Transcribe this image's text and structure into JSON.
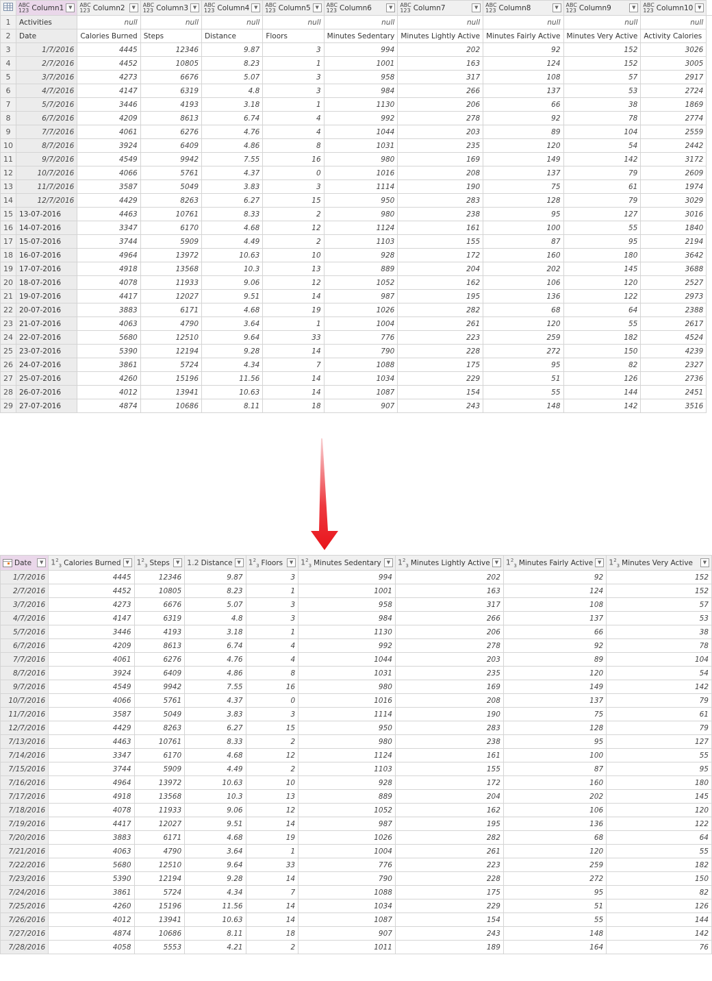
{
  "top_table": {
    "columns": [
      {
        "type": "ABC\n123",
        "name": "Column1"
      },
      {
        "type": "ABC\n123",
        "name": "Column2"
      },
      {
        "type": "ABC\n123",
        "name": "Column3"
      },
      {
        "type": "ABC\n123",
        "name": "Column4"
      },
      {
        "type": "ABC\n123",
        "name": "Column5"
      },
      {
        "type": "ABC\n123",
        "name": "Column6"
      },
      {
        "type": "ABC\n123",
        "name": "Column7"
      },
      {
        "type": "ABC\n123",
        "name": "Column8"
      },
      {
        "type": "ABC\n123",
        "name": "Column9"
      },
      {
        "type": "ABC\n123",
        "name": "Column10"
      }
    ],
    "rows": [
      [
        "Activities",
        "null",
        "null",
        "null",
        "null",
        "null",
        "null",
        "null",
        "null",
        "null"
      ],
      [
        "Date",
        "Calories Burned",
        "Steps",
        "Distance",
        "Floors",
        "Minutes Sedentary",
        "Minutes Lightly Active",
        "Minutes Fairly Active",
        "Minutes Very Active",
        "Activity Calories"
      ],
      [
        "1/7/2016",
        "4445",
        "12346",
        "9.87",
        "3",
        "994",
        "202",
        "92",
        "152",
        "3026"
      ],
      [
        "2/7/2016",
        "4452",
        "10805",
        "8.23",
        "1",
        "1001",
        "163",
        "124",
        "152",
        "3005"
      ],
      [
        "3/7/2016",
        "4273",
        "6676",
        "5.07",
        "3",
        "958",
        "317",
        "108",
        "57",
        "2917"
      ],
      [
        "4/7/2016",
        "4147",
        "6319",
        "4.8",
        "3",
        "984",
        "266",
        "137",
        "53",
        "2724"
      ],
      [
        "5/7/2016",
        "3446",
        "4193",
        "3.18",
        "1",
        "1130",
        "206",
        "66",
        "38",
        "1869"
      ],
      [
        "6/7/2016",
        "4209",
        "8613",
        "6.74",
        "4",
        "992",
        "278",
        "92",
        "78",
        "2774"
      ],
      [
        "7/7/2016",
        "4061",
        "6276",
        "4.76",
        "4",
        "1044",
        "203",
        "89",
        "104",
        "2559"
      ],
      [
        "8/7/2016",
        "3924",
        "6409",
        "4.86",
        "8",
        "1031",
        "235",
        "120",
        "54",
        "2442"
      ],
      [
        "9/7/2016",
        "4549",
        "9942",
        "7.55",
        "16",
        "980",
        "169",
        "149",
        "142",
        "3172"
      ],
      [
        "10/7/2016",
        "4066",
        "5761",
        "4.37",
        "0",
        "1016",
        "208",
        "137",
        "79",
        "2609"
      ],
      [
        "11/7/2016",
        "3587",
        "5049",
        "3.83",
        "3",
        "1114",
        "190",
        "75",
        "61",
        "1974"
      ],
      [
        "12/7/2016",
        "4429",
        "8263",
        "6.27",
        "15",
        "950",
        "283",
        "128",
        "79",
        "3029"
      ],
      [
        "13-07-2016",
        "4463",
        "10761",
        "8.33",
        "2",
        "980",
        "238",
        "95",
        "127",
        "3016"
      ],
      [
        "14-07-2016",
        "3347",
        "6170",
        "4.68",
        "12",
        "1124",
        "161",
        "100",
        "55",
        "1840"
      ],
      [
        "15-07-2016",
        "3744",
        "5909",
        "4.49",
        "2",
        "1103",
        "155",
        "87",
        "95",
        "2194"
      ],
      [
        "16-07-2016",
        "4964",
        "13972",
        "10.63",
        "10",
        "928",
        "172",
        "160",
        "180",
        "3642"
      ],
      [
        "17-07-2016",
        "4918",
        "13568",
        "10.3",
        "13",
        "889",
        "204",
        "202",
        "145",
        "3688"
      ],
      [
        "18-07-2016",
        "4078",
        "11933",
        "9.06",
        "12",
        "1052",
        "162",
        "106",
        "120",
        "2527"
      ],
      [
        "19-07-2016",
        "4417",
        "12027",
        "9.51",
        "14",
        "987",
        "195",
        "136",
        "122",
        "2973"
      ],
      [
        "20-07-2016",
        "3883",
        "6171",
        "4.68",
        "19",
        "1026",
        "282",
        "68",
        "64",
        "2388"
      ],
      [
        "21-07-2016",
        "4063",
        "4790",
        "3.64",
        "1",
        "1004",
        "261",
        "120",
        "55",
        "2617"
      ],
      [
        "22-07-2016",
        "5680",
        "12510",
        "9.64",
        "33",
        "776",
        "223",
        "259",
        "182",
        "4524"
      ],
      [
        "23-07-2016",
        "5390",
        "12194",
        "9.28",
        "14",
        "790",
        "228",
        "272",
        "150",
        "4239"
      ],
      [
        "24-07-2016",
        "3861",
        "5724",
        "4.34",
        "7",
        "1088",
        "175",
        "95",
        "82",
        "2327"
      ],
      [
        "25-07-2016",
        "4260",
        "15196",
        "11.56",
        "14",
        "1034",
        "229",
        "51",
        "126",
        "2736"
      ],
      [
        "26-07-2016",
        "4012",
        "13941",
        "10.63",
        "14",
        "1087",
        "154",
        "55",
        "144",
        "2451"
      ],
      [
        "27-07-2016",
        "4874",
        "10686",
        "8.11",
        "18",
        "907",
        "243",
        "148",
        "142",
        "3516"
      ]
    ]
  },
  "arrow": {
    "icon": "down-arrow-icon",
    "color": "#e8141b"
  },
  "bottom_table": {
    "columns": [
      {
        "type": "date",
        "name": "Date"
      },
      {
        "type": "1²₃",
        "name": "Calories Burned"
      },
      {
        "type": "1²₃",
        "name": "Steps"
      },
      {
        "type": "1.2",
        "name": "Distance"
      },
      {
        "type": "1²₃",
        "name": "Floors"
      },
      {
        "type": "1²₃",
        "name": "Minutes Sedentary"
      },
      {
        "type": "1²₃",
        "name": "Minutes Lightly Active"
      },
      {
        "type": "1²₃",
        "name": "Minutes Fairly Active"
      },
      {
        "type": "1²₃",
        "name": "Minutes Very Active"
      }
    ],
    "rows": [
      [
        "1/7/2016",
        "4445",
        "12346",
        "9.87",
        "3",
        "994",
        "202",
        "92",
        "152"
      ],
      [
        "2/7/2016",
        "4452",
        "10805",
        "8.23",
        "1",
        "1001",
        "163",
        "124",
        "152"
      ],
      [
        "3/7/2016",
        "4273",
        "6676",
        "5.07",
        "3",
        "958",
        "317",
        "108",
        "57"
      ],
      [
        "4/7/2016",
        "4147",
        "6319",
        "4.8",
        "3",
        "984",
        "266",
        "137",
        "53"
      ],
      [
        "5/7/2016",
        "3446",
        "4193",
        "3.18",
        "1",
        "1130",
        "206",
        "66",
        "38"
      ],
      [
        "6/7/2016",
        "4209",
        "8613",
        "6.74",
        "4",
        "992",
        "278",
        "92",
        "78"
      ],
      [
        "7/7/2016",
        "4061",
        "6276",
        "4.76",
        "4",
        "1044",
        "203",
        "89",
        "104"
      ],
      [
        "8/7/2016",
        "3924",
        "6409",
        "4.86",
        "8",
        "1031",
        "235",
        "120",
        "54"
      ],
      [
        "9/7/2016",
        "4549",
        "9942",
        "7.55",
        "16",
        "980",
        "169",
        "149",
        "142"
      ],
      [
        "10/7/2016",
        "4066",
        "5761",
        "4.37",
        "0",
        "1016",
        "208",
        "137",
        "79"
      ],
      [
        "11/7/2016",
        "3587",
        "5049",
        "3.83",
        "3",
        "1114",
        "190",
        "75",
        "61"
      ],
      [
        "12/7/2016",
        "4429",
        "8263",
        "6.27",
        "15",
        "950",
        "283",
        "128",
        "79"
      ],
      [
        "7/13/2016",
        "4463",
        "10761",
        "8.33",
        "2",
        "980",
        "238",
        "95",
        "127"
      ],
      [
        "7/14/2016",
        "3347",
        "6170",
        "4.68",
        "12",
        "1124",
        "161",
        "100",
        "55"
      ],
      [
        "7/15/2016",
        "3744",
        "5909",
        "4.49",
        "2",
        "1103",
        "155",
        "87",
        "95"
      ],
      [
        "7/16/2016",
        "4964",
        "13972",
        "10.63",
        "10",
        "928",
        "172",
        "160",
        "180"
      ],
      [
        "7/17/2016",
        "4918",
        "13568",
        "10.3",
        "13",
        "889",
        "204",
        "202",
        "145"
      ],
      [
        "7/18/2016",
        "4078",
        "11933",
        "9.06",
        "12",
        "1052",
        "162",
        "106",
        "120"
      ],
      [
        "7/19/2016",
        "4417",
        "12027",
        "9.51",
        "14",
        "987",
        "195",
        "136",
        "122"
      ],
      [
        "7/20/2016",
        "3883",
        "6171",
        "4.68",
        "19",
        "1026",
        "282",
        "68",
        "64"
      ],
      [
        "7/21/2016",
        "4063",
        "4790",
        "3.64",
        "1",
        "1004",
        "261",
        "120",
        "55"
      ],
      [
        "7/22/2016",
        "5680",
        "12510",
        "9.64",
        "33",
        "776",
        "223",
        "259",
        "182"
      ],
      [
        "7/23/2016",
        "5390",
        "12194",
        "9.28",
        "14",
        "790",
        "228",
        "272",
        "150"
      ],
      [
        "7/24/2016",
        "3861",
        "5724",
        "4.34",
        "7",
        "1088",
        "175",
        "95",
        "82"
      ],
      [
        "7/25/2016",
        "4260",
        "15196",
        "11.56",
        "14",
        "1034",
        "229",
        "51",
        "126"
      ],
      [
        "7/26/2016",
        "4012",
        "13941",
        "10.63",
        "14",
        "1087",
        "154",
        "55",
        "144"
      ],
      [
        "7/27/2016",
        "4874",
        "10686",
        "8.11",
        "18",
        "907",
        "243",
        "148",
        "142"
      ],
      [
        "7/28/2016",
        "4058",
        "5553",
        "4.21",
        "2",
        "1011",
        "189",
        "164",
        "76"
      ]
    ]
  }
}
